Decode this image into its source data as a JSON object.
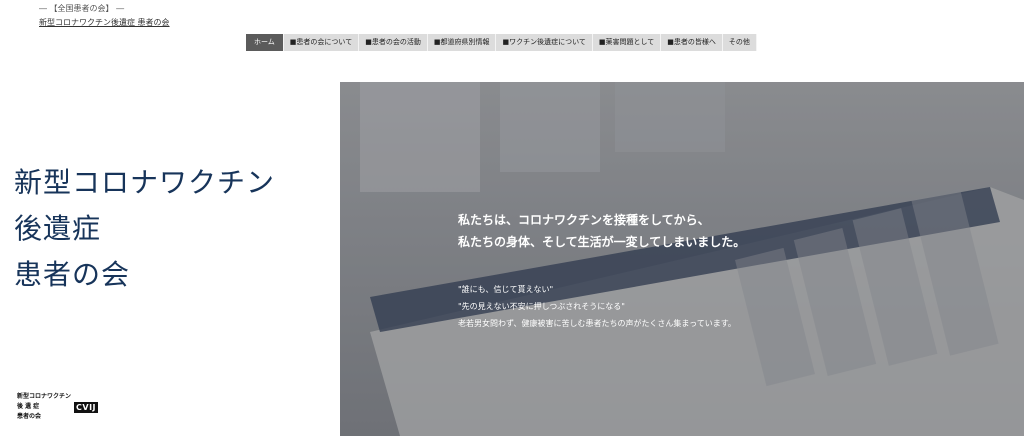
{
  "header": {
    "tagline": "― 【全国患者の会】 ―",
    "site_title": "新型コロナワクチン後遺症 患者の会"
  },
  "nav": {
    "items": [
      "ホーム",
      "■患者の会について",
      "■患者の会の活動",
      "■都道府県別情報",
      "■ワクチン後遺症について",
      "■薬害問題として",
      "■患者の皆様へ",
      "その他"
    ],
    "active_index": 0
  },
  "hero": {
    "title_lines": [
      "新型コロナワクチン",
      "後遺症",
      "患者の会"
    ],
    "lead_lines": [
      "私たちは、コロナワクチンを接種をしてから、",
      "私たちの身体、そして生活が一変してしまいました。"
    ],
    "sub_lines": [
      "\"誰にも、信じて貰えない\"",
      "\"先の見えない不安に押しつぶされそうになる\"",
      "老若男女問わず、健康被害に苦しむ患者たちの声がたくさん集まっています。"
    ]
  },
  "footer_logo": {
    "lines": [
      "新型コロナワクチン",
      "後 遺 症",
      "患者の会"
    ],
    "badge": "CVIJ"
  },
  "colors": {
    "title": "#17345a",
    "nav_active_bg": "#5b5b5b",
    "nav_bg": "#dcdcdc"
  }
}
